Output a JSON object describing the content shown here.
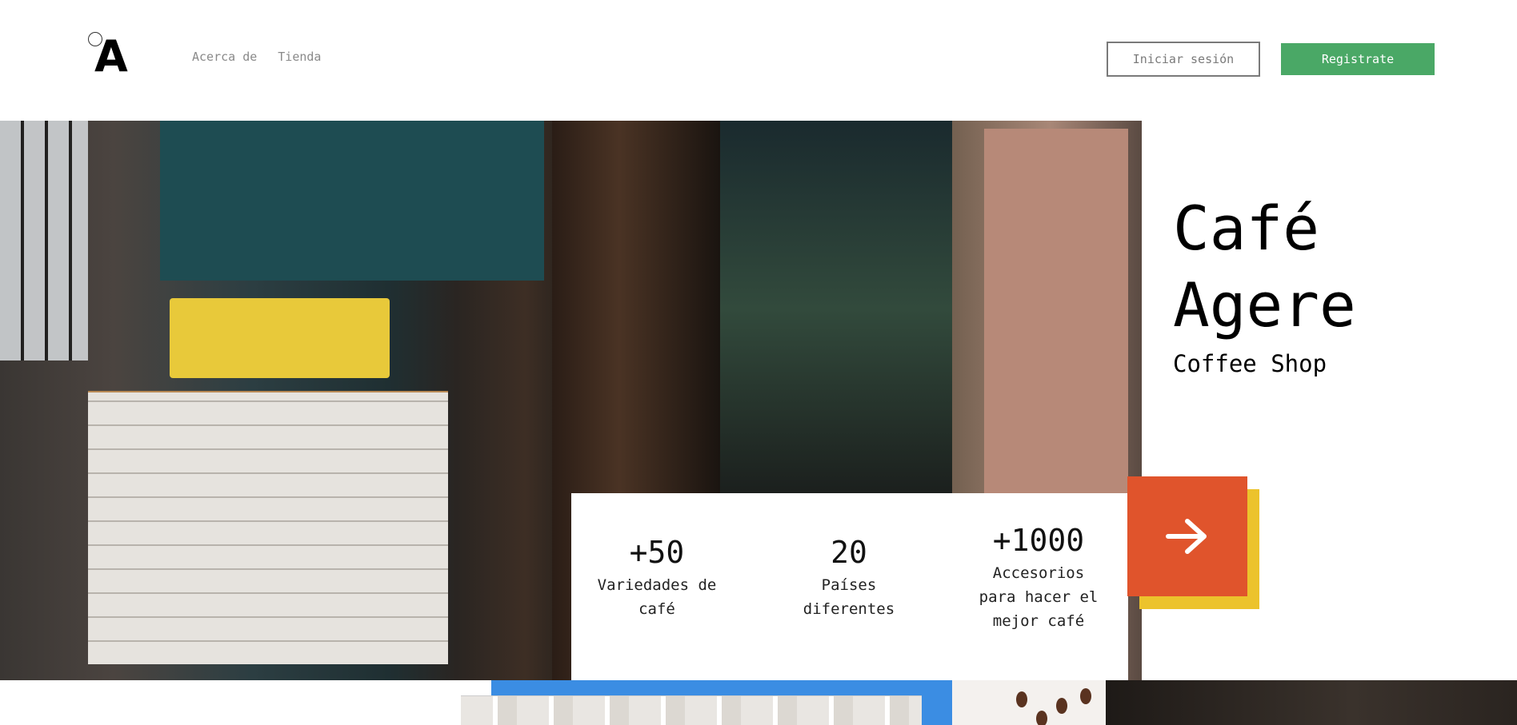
{
  "header": {
    "logo_letter": "A",
    "nav": [
      "Acerca de",
      "Tienda"
    ],
    "login_label": "Iniciar sesión",
    "register_label": "Registrate"
  },
  "hero": {
    "title_line1": "Café",
    "title_line2": "Agere",
    "subtitle": "Coffee Shop"
  },
  "stats": [
    {
      "value": "+50",
      "label_line1": "Variedades de",
      "label_line2": "café",
      "label_line3": ""
    },
    {
      "value": "20",
      "label_line1": "Países",
      "label_line2": "diferentes",
      "label_line3": ""
    },
    {
      "value": "+1000",
      "label_line1": "Accesorios",
      "label_line2": "para hacer el",
      "label_line3": "mejor café"
    }
  ],
  "cta": {
    "icon": "arrow-right-icon"
  },
  "colors": {
    "register": "#4aa866",
    "cta": "#e0542c",
    "cta_shadow": "#ecc32c",
    "map_frame": "#3b8de3"
  }
}
